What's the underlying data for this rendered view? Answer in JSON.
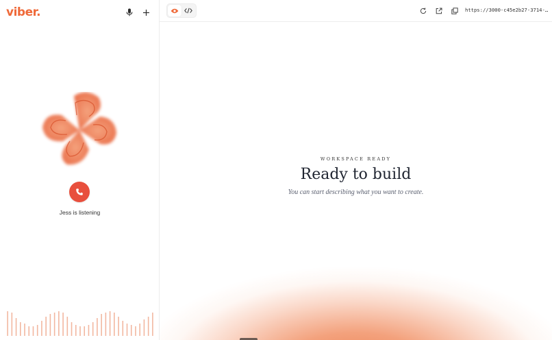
{
  "app": {
    "logo_text": "viber.",
    "brand_color": "#ef6a3a"
  },
  "left_panel": {
    "header_icons": [
      "microphone-icon",
      "plus-icon"
    ],
    "call": {
      "icon": "phone-icon",
      "color": "#e84f3d"
    },
    "status_text": "Jess is listening"
  },
  "toolbar": {
    "view_toggle": [
      {
        "icon": "eye-icon",
        "active": true
      },
      {
        "icon": "code-icon",
        "active": false
      }
    ],
    "actions": [
      "refresh-icon",
      "external-link-icon",
      "copy-icon"
    ],
    "url": "https://3000-c45e2b27-3714-4…"
  },
  "preview": {
    "eyebrow": "WORKSPACE READY",
    "headline": "Ready to build",
    "subtitle": "You can start describing what you want to create."
  }
}
